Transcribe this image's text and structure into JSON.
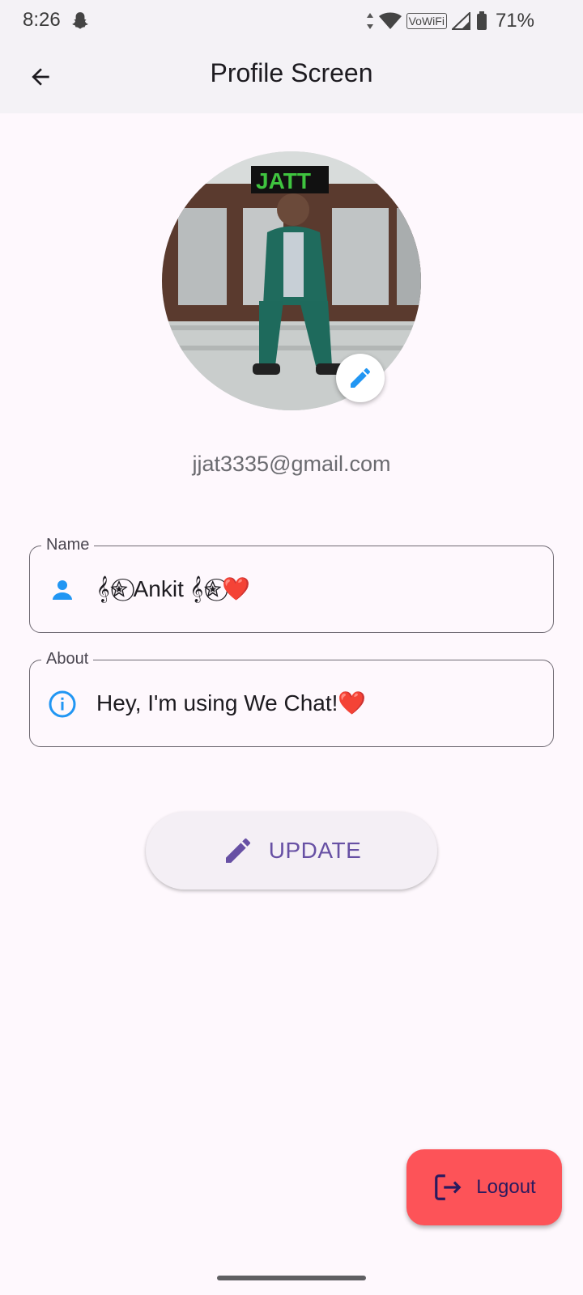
{
  "status_bar": {
    "time": "8:26",
    "network_label": "VoWiFi",
    "battery_percent": "71%"
  },
  "app_bar": {
    "title": "Profile Screen"
  },
  "profile": {
    "email": "jjat3335@gmail.com",
    "name_label": "Name",
    "name_value": "𝄞✮⃝ Ankit 𝄞✮⃝❤️",
    "about_label": "About",
    "about_value": "Hey, I'm using We Chat!❤️"
  },
  "actions": {
    "update_label": "UPDATE",
    "logout_label": "Logout"
  },
  "colors": {
    "accent": "#2196f3",
    "primary": "#6750a4",
    "logout_bg": "#fd5358"
  },
  "icons": [
    "back-arrow-icon",
    "pencil-icon",
    "person-icon",
    "info-icon",
    "logout-icon"
  ]
}
